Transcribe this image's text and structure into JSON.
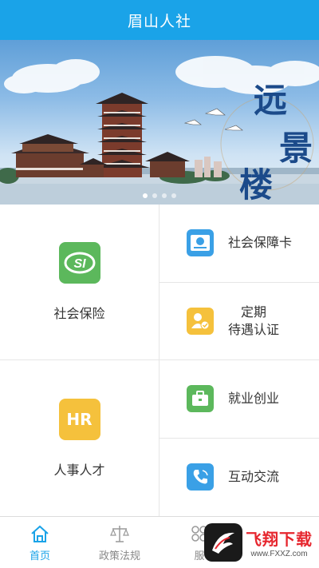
{
  "header": {
    "title": "眉山人社"
  },
  "banner": {
    "calligraphy": [
      "远",
      "景",
      "楼"
    ],
    "slide_count": 4,
    "active_slide": 1
  },
  "menu": {
    "social_insurance": {
      "label": "社会保险",
      "icon_text": "SI",
      "color": "#5cb85c"
    },
    "hr_talent": {
      "label": "人事人才",
      "icon_text": "HR",
      "color": "#f5c13c"
    },
    "social_card": {
      "label": "社会保障卡",
      "color": "#3aa0e6"
    },
    "certification": {
      "label_line1": "定期",
      "label_line2": "待遇认证",
      "color": "#f5c13c"
    },
    "employment": {
      "label": "就业创业",
      "color": "#5cb85c"
    },
    "interaction": {
      "label": "互动交流",
      "color": "#3aa0e6"
    }
  },
  "tabs": [
    {
      "label": "首页",
      "icon": "home-icon",
      "active": true
    },
    {
      "label": "政策法规",
      "icon": "scales-icon",
      "active": false
    },
    {
      "label": "服",
      "icon": "service-icon",
      "active": false
    }
  ],
  "watermark": {
    "title": "飞翔下载",
    "url": "www.FXXZ.com"
  },
  "colors": {
    "accent": "#1aa3e8"
  }
}
